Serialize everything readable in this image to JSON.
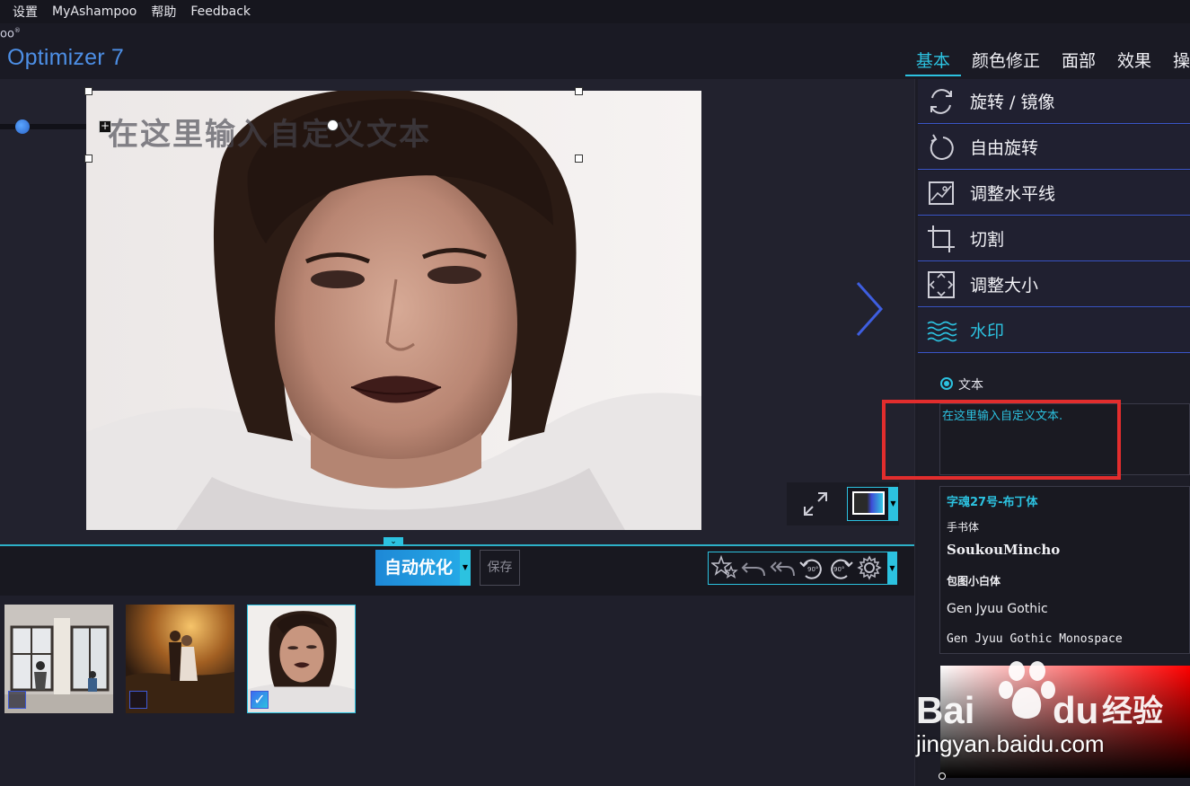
{
  "menu": [
    "设置",
    "MyAshampoo",
    "帮助",
    "Feedback"
  ],
  "app": {
    "brand_fragment": "oo",
    "title": "Optimizer 7"
  },
  "tabs": [
    "基本",
    "颜色修正",
    "面部",
    "效果",
    "操"
  ],
  "active_tab": 0,
  "photo": {
    "watermark_preview": "在这里输入自定义文本"
  },
  "toolbar": {
    "auto_optimize": "自动优化",
    "save": "保存"
  },
  "tools_icons": [
    "magic-stars-icon",
    "undo-icon",
    "undo-all-icon",
    "rotate-left-90-icon",
    "rotate-right-90-icon",
    "gear-icon"
  ],
  "rotate_label": "90°",
  "thumbnails": [
    {
      "name": "family-window-photo",
      "checked": false
    },
    {
      "name": "couple-sunset-photo",
      "checked": false
    },
    {
      "name": "woman-portrait-photo",
      "checked": true
    }
  ],
  "panel": {
    "items": [
      {
        "label": "旋转 / 镜像",
        "icon": "rotate-mirror-icon"
      },
      {
        "label": "自由旋转",
        "icon": "free-rotate-icon"
      },
      {
        "label": "调整水平线",
        "icon": "horizon-icon"
      },
      {
        "label": "切割",
        "icon": "crop-icon"
      },
      {
        "label": "调整大小",
        "icon": "resize-icon"
      },
      {
        "label": "水印",
        "icon": "watermark-icon"
      }
    ],
    "active_item": 5
  },
  "watermark": {
    "mode_label": "文本",
    "text_value": "在这里输入自定义文本.",
    "fonts": [
      "字魂27号-布丁体",
      "手书体",
      "SoukouMincho",
      "包图小白体",
      "Gen Jyuu Gothic",
      "Gen Jyuu Gothic Monospace"
    ]
  },
  "overlay": {
    "site": "jingyan.baidu.com",
    "brand_text": "Bai",
    "brand_text2": "du",
    "brand_cn": "经验"
  },
  "colors": {
    "accent": "#2cc2e0",
    "brand_blue": "#4d8fe6",
    "highlight_red": "#e22d2d"
  }
}
